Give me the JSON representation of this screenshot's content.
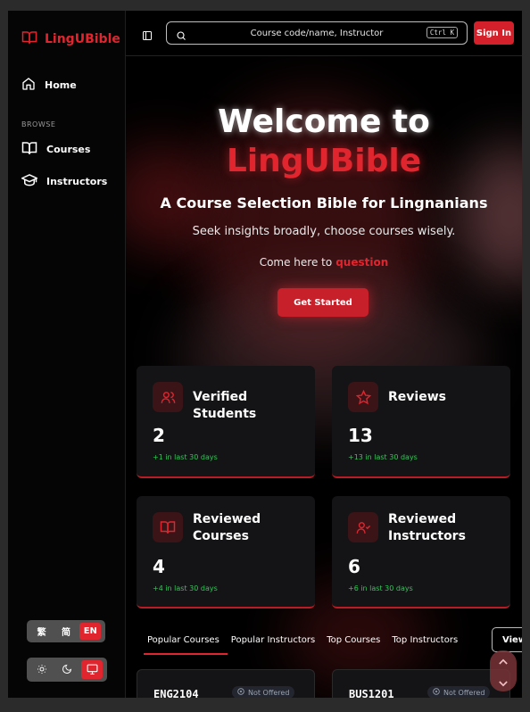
{
  "brand": {
    "name": "LingUBible",
    "accent": "#e0252e"
  },
  "sidebar": {
    "home_label": "Home",
    "section_label": "BROWSE",
    "items": [
      {
        "label": "Courses",
        "icon": "book-icon"
      },
      {
        "label": "Instructors",
        "icon": "graduation-cap-icon"
      }
    ],
    "languages": [
      "繁",
      "简",
      "EN"
    ],
    "active_language": "EN",
    "themes": [
      "sun-icon",
      "moon-icon",
      "monitor-icon"
    ],
    "active_theme": "monitor-icon"
  },
  "topbar": {
    "search_placeholder": "Course code/name, Instructor",
    "shortcut": "Ctrl K",
    "signin_label": "Sign In"
  },
  "hero": {
    "title_line1": "Welcome to",
    "title_line2": "LingUBible",
    "subtitle": "A Course Selection Bible for Lingnanians",
    "tagline": "Seek insights broadly, choose courses wisely.",
    "come_prefix": "Come here to",
    "come_word": "question",
    "cta_label": "Get Started"
  },
  "stats": [
    {
      "title": "Verified Students",
      "value": "2",
      "delta": "+1 in last 30 days",
      "icon": "users-icon"
    },
    {
      "title": "Reviews",
      "value": "13",
      "delta": "+13 in last 30 days",
      "icon": "star-icon"
    },
    {
      "title": "Reviewed Courses",
      "value": "4",
      "delta": "+4 in last 30 days",
      "icon": "book-open-icon"
    },
    {
      "title": "Reviewed Instructors",
      "value": "6",
      "delta": "+6 in last 30 days",
      "icon": "user-check-icon"
    }
  ],
  "tabs": {
    "items": [
      "Popular Courses",
      "Popular Instructors",
      "Top Courses",
      "Top Instructors"
    ],
    "active": "Popular Courses",
    "view_all": "View All"
  },
  "course_cards": [
    {
      "code": "ENG2104",
      "status": "Not Offered"
    },
    {
      "code": "BUS1201",
      "status": "Not Offered"
    }
  ]
}
